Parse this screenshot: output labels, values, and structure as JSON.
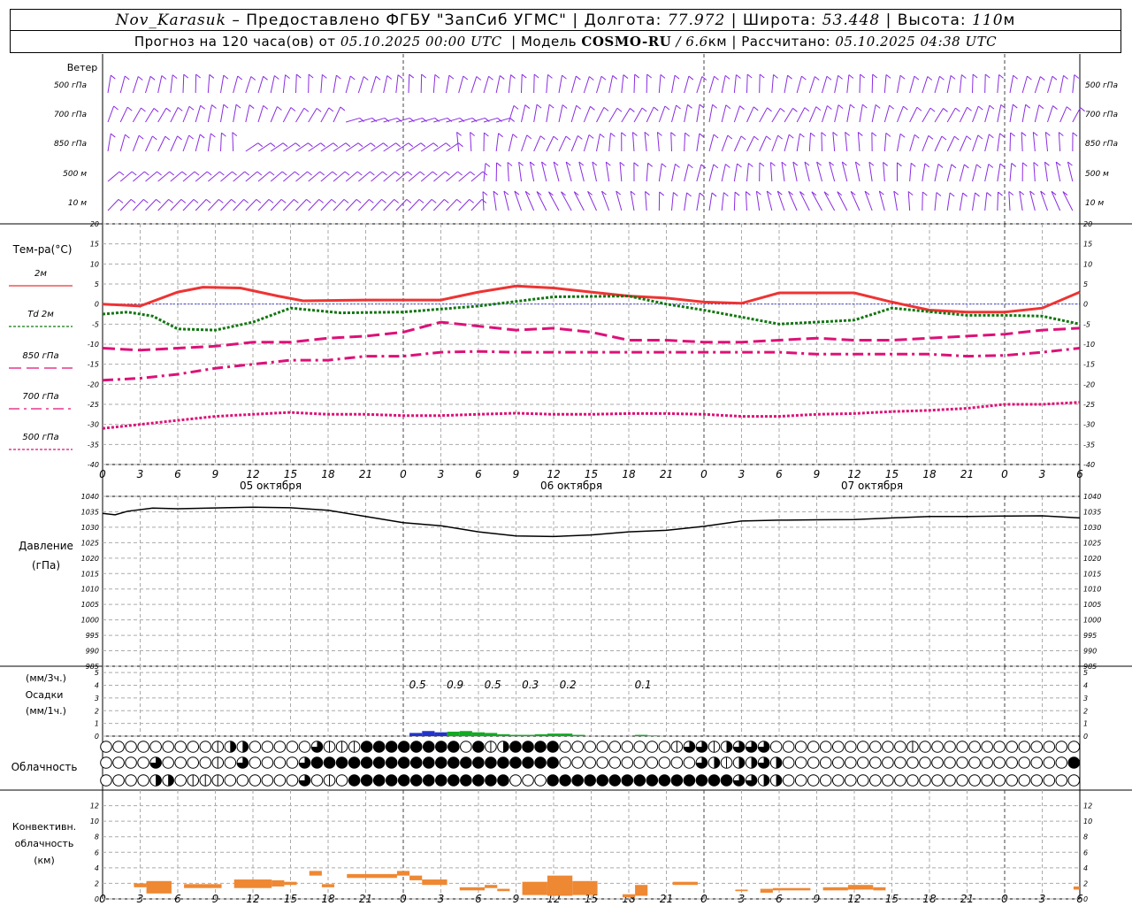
{
  "header": {
    "station": "Nov_Karasuk",
    "dash": "–",
    "provider": "Предоставлено ФГБУ \"ЗапСиб УГМС\"",
    "lon_label": "Долгота:",
    "lon_value": "77.972",
    "lat_label": "Широта:",
    "lat_value": "53.448",
    "alt_label": "Высота:",
    "alt_value": "110",
    "alt_unit": "м",
    "forecast_label": "Прогноз на 120 часа(ов)  от",
    "forecast_start": "05.10.2025 00:00 UTC",
    "model_label": "Модель",
    "model_name": "COSMO-RU",
    "model_res": "/ 6.6",
    "model_res_unit": "км",
    "calc_label": "Рассчитано:",
    "calc_time": "05.10.2025 04:38 UTC",
    "sep": "|"
  },
  "chart_data": {
    "type": "line",
    "x_hours": [
      0,
      3,
      6,
      9,
      12,
      15,
      18,
      21,
      24,
      27,
      30,
      33,
      36,
      39,
      42,
      45,
      48,
      51,
      54,
      57,
      60,
      63,
      66,
      69,
      72,
      75,
      78
    ],
    "x_tick_labels": [
      "0",
      "3",
      "6",
      "9",
      "12",
      "15",
      "18",
      "21",
      "0",
      "3",
      "6",
      "9",
      "12",
      "15",
      "18",
      "21",
      "0",
      "3",
      "6",
      "9",
      "12",
      "15",
      "18",
      "21",
      "0",
      "3",
      "6"
    ],
    "day_labels": [
      "05 октября",
      "06 октября",
      "07 октября"
    ],
    "wind": {
      "title": "Ветер",
      "levels": [
        "500 гПа",
        "700 гПа",
        "850 гПа",
        "500 м",
        "10  м"
      ],
      "color": "#8a2be2"
    },
    "temperature": {
      "title": "Тем-ра(°C)",
      "ylim": [
        -40,
        20
      ],
      "yticks": [
        20,
        15,
        10,
        5,
        0,
        -5,
        -10,
        -15,
        -20,
        -25,
        -30,
        -35,
        -40
      ],
      "series": [
        {
          "name": "2м",
          "color": "#ee3333",
          "style": "solid",
          "points": [
            [
              0,
              0
            ],
            [
              3,
              -0.5
            ],
            [
              6,
              3
            ],
            [
              8,
              4.2
            ],
            [
              11,
              4
            ],
            [
              14,
              2
            ],
            [
              16,
              0.8
            ],
            [
              21,
              1
            ],
            [
              27,
              1
            ],
            [
              30,
              3
            ],
            [
              33,
              4.5
            ],
            [
              36,
              4
            ],
            [
              39,
              3
            ],
            [
              42,
              2
            ],
            [
              45,
              1.5
            ],
            [
              48,
              0.5
            ],
            [
              51,
              0.2
            ],
            [
              54,
              2.8
            ],
            [
              57,
              2.8
            ],
            [
              60,
              2.8
            ],
            [
              63,
              0.5
            ],
            [
              66,
              -1.5
            ],
            [
              69,
              -2
            ],
            [
              72,
              -2
            ],
            [
              75,
              -1
            ],
            [
              78,
              3
            ]
          ]
        },
        {
          "name": "Td  2м",
          "color": "#117711",
          "style": "dotted",
          "points": [
            [
              0,
              -2.5
            ],
            [
              2,
              -2
            ],
            [
              4,
              -3
            ],
            [
              6,
              -6.2
            ],
            [
              9,
              -6.5
            ],
            [
              12,
              -4.5
            ],
            [
              15,
              -1
            ],
            [
              19,
              -2.2
            ],
            [
              24,
              -2
            ],
            [
              30,
              -0.5
            ],
            [
              36,
              1.8
            ],
            [
              42,
              2
            ],
            [
              45,
              0
            ],
            [
              48,
              -1.5
            ],
            [
              54,
              -5
            ],
            [
              60,
              -4
            ],
            [
              63,
              -1
            ],
            [
              69,
              -2.8
            ],
            [
              72,
              -2.8
            ],
            [
              75,
              -3
            ],
            [
              78,
              -5
            ]
          ]
        },
        {
          "name": "850 гПа",
          "color": "#dd1177",
          "style": "dashed",
          "points": [
            [
              0,
              -11
            ],
            [
              3,
              -11.5
            ],
            [
              6,
              -11
            ],
            [
              9,
              -10.5
            ],
            [
              12,
              -9.5
            ],
            [
              15,
              -9.5
            ],
            [
              18,
              -8.5
            ],
            [
              21,
              -8
            ],
            [
              24,
              -7
            ],
            [
              27,
              -4.5
            ],
            [
              30,
              -5.5
            ],
            [
              33,
              -6.5
            ],
            [
              36,
              -6
            ],
            [
              39,
              -7
            ],
            [
              42,
              -9
            ],
            [
              45,
              -9
            ],
            [
              48,
              -9.5
            ],
            [
              51,
              -9.5
            ],
            [
              54,
              -9
            ],
            [
              57,
              -8.5
            ],
            [
              60,
              -9
            ],
            [
              63,
              -9
            ],
            [
              66,
              -8.5
            ],
            [
              69,
              -8
            ],
            [
              72,
              -7.5
            ],
            [
              75,
              -6.5
            ],
            [
              78,
              -6
            ]
          ]
        },
        {
          "name": "700 гПа",
          "color": "#dd1177",
          "style": "dashdot",
          "points": [
            [
              0,
              -19
            ],
            [
              3,
              -18.5
            ],
            [
              6,
              -17.5
            ],
            [
              9,
              -16
            ],
            [
              12,
              -15
            ],
            [
              15,
              -14
            ],
            [
              18,
              -14
            ],
            [
              21,
              -13
            ],
            [
              24,
              -13
            ],
            [
              27,
              -12
            ],
            [
              30,
              -11.8
            ],
            [
              33,
              -12
            ],
            [
              36,
              -12
            ],
            [
              39,
              -12
            ],
            [
              42,
              -12
            ],
            [
              45,
              -12
            ],
            [
              48,
              -12
            ],
            [
              51,
              -12
            ],
            [
              54,
              -12
            ],
            [
              57,
              -12.5
            ],
            [
              60,
              -12.5
            ],
            [
              63,
              -12.5
            ],
            [
              66,
              -12.5
            ],
            [
              69,
              -13
            ],
            [
              72,
              -12.8
            ],
            [
              75,
              -12
            ],
            [
              78,
              -11
            ]
          ]
        },
        {
          "name": "500 гПа",
          "color": "#dd1177",
          "style": "dotted",
          "points": [
            [
              0,
              -31
            ],
            [
              3,
              -30
            ],
            [
              6,
              -29
            ],
            [
              9,
              -28
            ],
            [
              12,
              -27.5
            ],
            [
              15,
              -27
            ],
            [
              18,
              -27.5
            ],
            [
              21,
              -27.5
            ],
            [
              24,
              -27.8
            ],
            [
              27,
              -27.8
            ],
            [
              30,
              -27.5
            ],
            [
              33,
              -27.2
            ],
            [
              36,
              -27.5
            ],
            [
              39,
              -27.5
            ],
            [
              42,
              -27.3
            ],
            [
              45,
              -27.3
            ],
            [
              48,
              -27.5
            ],
            [
              51,
              -28
            ],
            [
              54,
              -28
            ],
            [
              57,
              -27.5
            ],
            [
              60,
              -27.3
            ],
            [
              63,
              -26.8
            ],
            [
              66,
              -26.5
            ],
            [
              69,
              -26
            ],
            [
              72,
              -25
            ],
            [
              75,
              -25
            ],
            [
              78,
              -24.5
            ]
          ]
        }
      ]
    },
    "pressure": {
      "title": "Давление",
      "unit": "(гПа)",
      "ylim": [
        985,
        1040
      ],
      "yticks": [
        1040,
        1035,
        1030,
        1025,
        1020,
        1015,
        1010,
        1005,
        1000,
        995,
        990,
        985
      ],
      "series": [
        {
          "name": "",
          "color": "#000000",
          "points": [
            [
              0,
              1034.5
            ],
            [
              1,
              1034
            ],
            [
              2,
              1035.2
            ],
            [
              4,
              1036.2
            ],
            [
              6,
              1036
            ],
            [
              12,
              1036.5
            ],
            [
              15,
              1036.3
            ],
            [
              18,
              1035.5
            ],
            [
              21,
              1033.5
            ],
            [
              24,
              1031.5
            ],
            [
              27,
              1030.5
            ],
            [
              30,
              1028.5
            ],
            [
              33,
              1027.2
            ],
            [
              36,
              1027
            ],
            [
              39,
              1027.5
            ],
            [
              42,
              1028.5
            ],
            [
              45,
              1029
            ],
            [
              48,
              1030.3
            ],
            [
              51,
              1032
            ],
            [
              54,
              1032.3
            ],
            [
              57,
              1032.4
            ],
            [
              60,
              1032.5
            ],
            [
              63,
              1033
            ],
            [
              66,
              1033.5
            ],
            [
              69,
              1033.5
            ],
            [
              72,
              1033.6
            ],
            [
              75,
              1033.7
            ],
            [
              78,
              1033
            ]
          ]
        }
      ]
    },
    "precipitation": {
      "title": "Осадки",
      "unit_top": "(мм/3ч.)",
      "unit_bottom": "(мм/1ч.)",
      "ylim": [
        0,
        5
      ],
      "yticks": [
        5,
        4,
        3,
        2,
        1,
        0
      ],
      "labels": [
        {
          "hour": 25,
          "text": "0.5"
        },
        {
          "hour": 28,
          "text": "0.9"
        },
        {
          "hour": 31,
          "text": "0.5"
        },
        {
          "hour": 34,
          "text": "0.3"
        },
        {
          "hour": 37,
          "text": "0.2"
        },
        {
          "hour": 43,
          "text": "0.1"
        }
      ],
      "bars": [
        {
          "hour": 25,
          "value": 0.25,
          "color": "#2233cc"
        },
        {
          "hour": 26,
          "value": 0.4,
          "color": "#2233cc"
        },
        {
          "hour": 27,
          "value": 0.3,
          "color": "#2233cc"
        },
        {
          "hour": 28,
          "value": 0.35,
          "color": "#11aa22"
        },
        {
          "hour": 29,
          "value": 0.4,
          "color": "#11aa22"
        },
        {
          "hour": 30,
          "value": 0.3,
          "color": "#11aa22"
        },
        {
          "hour": 31,
          "value": 0.25,
          "color": "#11aa22"
        },
        {
          "hour": 32,
          "value": 0.15,
          "color": "#11aa22"
        },
        {
          "hour": 33,
          "value": 0.1,
          "color": "#11aa22"
        },
        {
          "hour": 34,
          "value": 0.1,
          "color": "#11aa22"
        },
        {
          "hour": 35,
          "value": 0.15,
          "color": "#11aa22"
        },
        {
          "hour": 36,
          "value": 0.2,
          "color": "#11aa22"
        },
        {
          "hour": 37,
          "value": 0.2,
          "color": "#11aa22"
        },
        {
          "hour": 38,
          "value": 0.1,
          "color": "#11aa22"
        },
        {
          "hour": 43,
          "value": 0.1,
          "color": "#11aa22"
        },
        {
          "hour": 44,
          "value": 0.05,
          "color": "#11aa22"
        }
      ]
    },
    "cloudiness": {
      "title": "Облачность",
      "rows": [
        "0000000001220000031114444444404124444000000000133123330000000000010000000000000",
        "0000300001030000344444444444444444444000000000003212232000000000000000000000004",
        "0000220111000000301044444444444440004444444444444443322000000000000000000000000"
      ]
    },
    "convective": {
      "title_line1": "Конвективн.",
      "title_line2": "облачность",
      "unit": "(км)",
      "ylim": [
        0,
        14
      ],
      "yticks": [
        12,
        10,
        8,
        6,
        4,
        2,
        0
      ],
      "bars": [
        {
          "start": 2.5,
          "end": 3.5,
          "bottom": 1.5,
          "top": 2.0
        },
        {
          "start": 3.5,
          "end": 5.5,
          "bottom": 0.7,
          "top": 2.3
        },
        {
          "start": 6.5,
          "end": 9.5,
          "bottom": 1.4,
          "top": 1.9
        },
        {
          "start": 10.5,
          "end": 13.5,
          "bottom": 1.4,
          "top": 2.5
        },
        {
          "start": 13.5,
          "end": 14.5,
          "bottom": 1.6,
          "top": 2.4
        },
        {
          "start": 14.5,
          "end": 15.5,
          "bottom": 1.8,
          "top": 2.2
        },
        {
          "start": 16.5,
          "end": 17.5,
          "bottom": 3.0,
          "top": 3.6
        },
        {
          "start": 17.5,
          "end": 18.5,
          "bottom": 1.5,
          "top": 1.9
        },
        {
          "start": 19.5,
          "end": 23.5,
          "bottom": 2.7,
          "top": 3.2
        },
        {
          "start": 23.5,
          "end": 24.5,
          "bottom": 3.0,
          "top": 3.6
        },
        {
          "start": 24.5,
          "end": 25.5,
          "bottom": 2.4,
          "top": 3.0
        },
        {
          "start": 25.5,
          "end": 27.5,
          "bottom": 1.8,
          "top": 2.5
        },
        {
          "start": 28.5,
          "end": 30.5,
          "bottom": 1.1,
          "top": 1.5
        },
        {
          "start": 30.5,
          "end": 31.5,
          "bottom": 1.4,
          "top": 1.8
        },
        {
          "start": 31.5,
          "end": 32.5,
          "bottom": 1.0,
          "top": 1.3
        },
        {
          "start": 33.5,
          "end": 35.5,
          "bottom": 0.5,
          "top": 2.2
        },
        {
          "start": 35.5,
          "end": 37.5,
          "bottom": 0.4,
          "top": 3.0
        },
        {
          "start": 37.5,
          "end": 39.5,
          "bottom": 0.5,
          "top": 2.3
        },
        {
          "start": 41.5,
          "end": 42.5,
          "bottom": 0.2,
          "top": 0.6
        },
        {
          "start": 42.5,
          "end": 43.5,
          "bottom": 0.4,
          "top": 1.8
        },
        {
          "start": 45.5,
          "end": 47.5,
          "bottom": 1.8,
          "top": 2.2
        },
        {
          "start": 50.5,
          "end": 51.5,
          "bottom": 1.0,
          "top": 1.2
        },
        {
          "start": 52.5,
          "end": 53.5,
          "bottom": 0.8,
          "top": 1.3
        },
        {
          "start": 53.5,
          "end": 56.5,
          "bottom": 1.1,
          "top": 1.4
        },
        {
          "start": 57.5,
          "end": 59.5,
          "bottom": 1.1,
          "top": 1.5
        },
        {
          "start": 59.5,
          "end": 61.5,
          "bottom": 1.2,
          "top": 1.8
        },
        {
          "start": 61.5,
          "end": 62.5,
          "bottom": 1.1,
          "top": 1.5
        },
        {
          "start": 77.5,
          "end": 78,
          "bottom": 1.2,
          "top": 1.6
        }
      ],
      "color": "#ee8833"
    }
  }
}
